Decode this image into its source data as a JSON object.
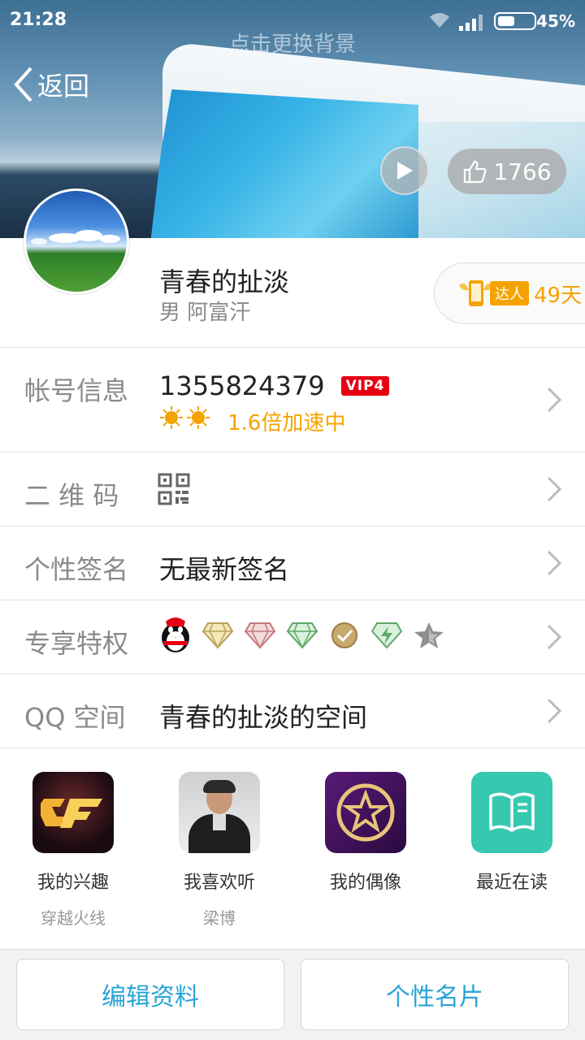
{
  "status_bar": {
    "time": "21:28",
    "battery": "45%"
  },
  "header": {
    "change_background": "点击更换背景",
    "back_label": "返回",
    "like_count": "1766"
  },
  "profile": {
    "nickname": "青春的扯淡",
    "gender_location": "男 阿富汗",
    "daren_badge": "达人",
    "daren_days": "49天"
  },
  "rows": {
    "account": {
      "label": "帐号信息",
      "qq_number": "1355824379",
      "vip": "VIP4",
      "speed": "1.6倍加速中"
    },
    "qrcode": {
      "label": "二 维 码"
    },
    "signature": {
      "label": "个性签名",
      "value": "无最新签名"
    },
    "privilege": {
      "label": "专享特权"
    },
    "qzone": {
      "label": "QQ 空间",
      "value": "青春的扯淡的空间"
    }
  },
  "apps": [
    {
      "title": "我的兴趣",
      "subtitle": "穿越火线",
      "icon": "crossfire-icon"
    },
    {
      "title": "我喜欢听",
      "subtitle": "梁博",
      "icon": "singer-photo-icon"
    },
    {
      "title": "我的偶像",
      "subtitle": "",
      "icon": "star-idol-icon"
    },
    {
      "title": "最近在读",
      "subtitle": "",
      "icon": "book-icon"
    }
  ],
  "buttons": {
    "edit_profile": "编辑资料",
    "personal_card": "个性名片"
  },
  "colors": {
    "accent_blue": "#2aa4d6",
    "orange": "#f5a300",
    "vip_red": "#e60012"
  }
}
